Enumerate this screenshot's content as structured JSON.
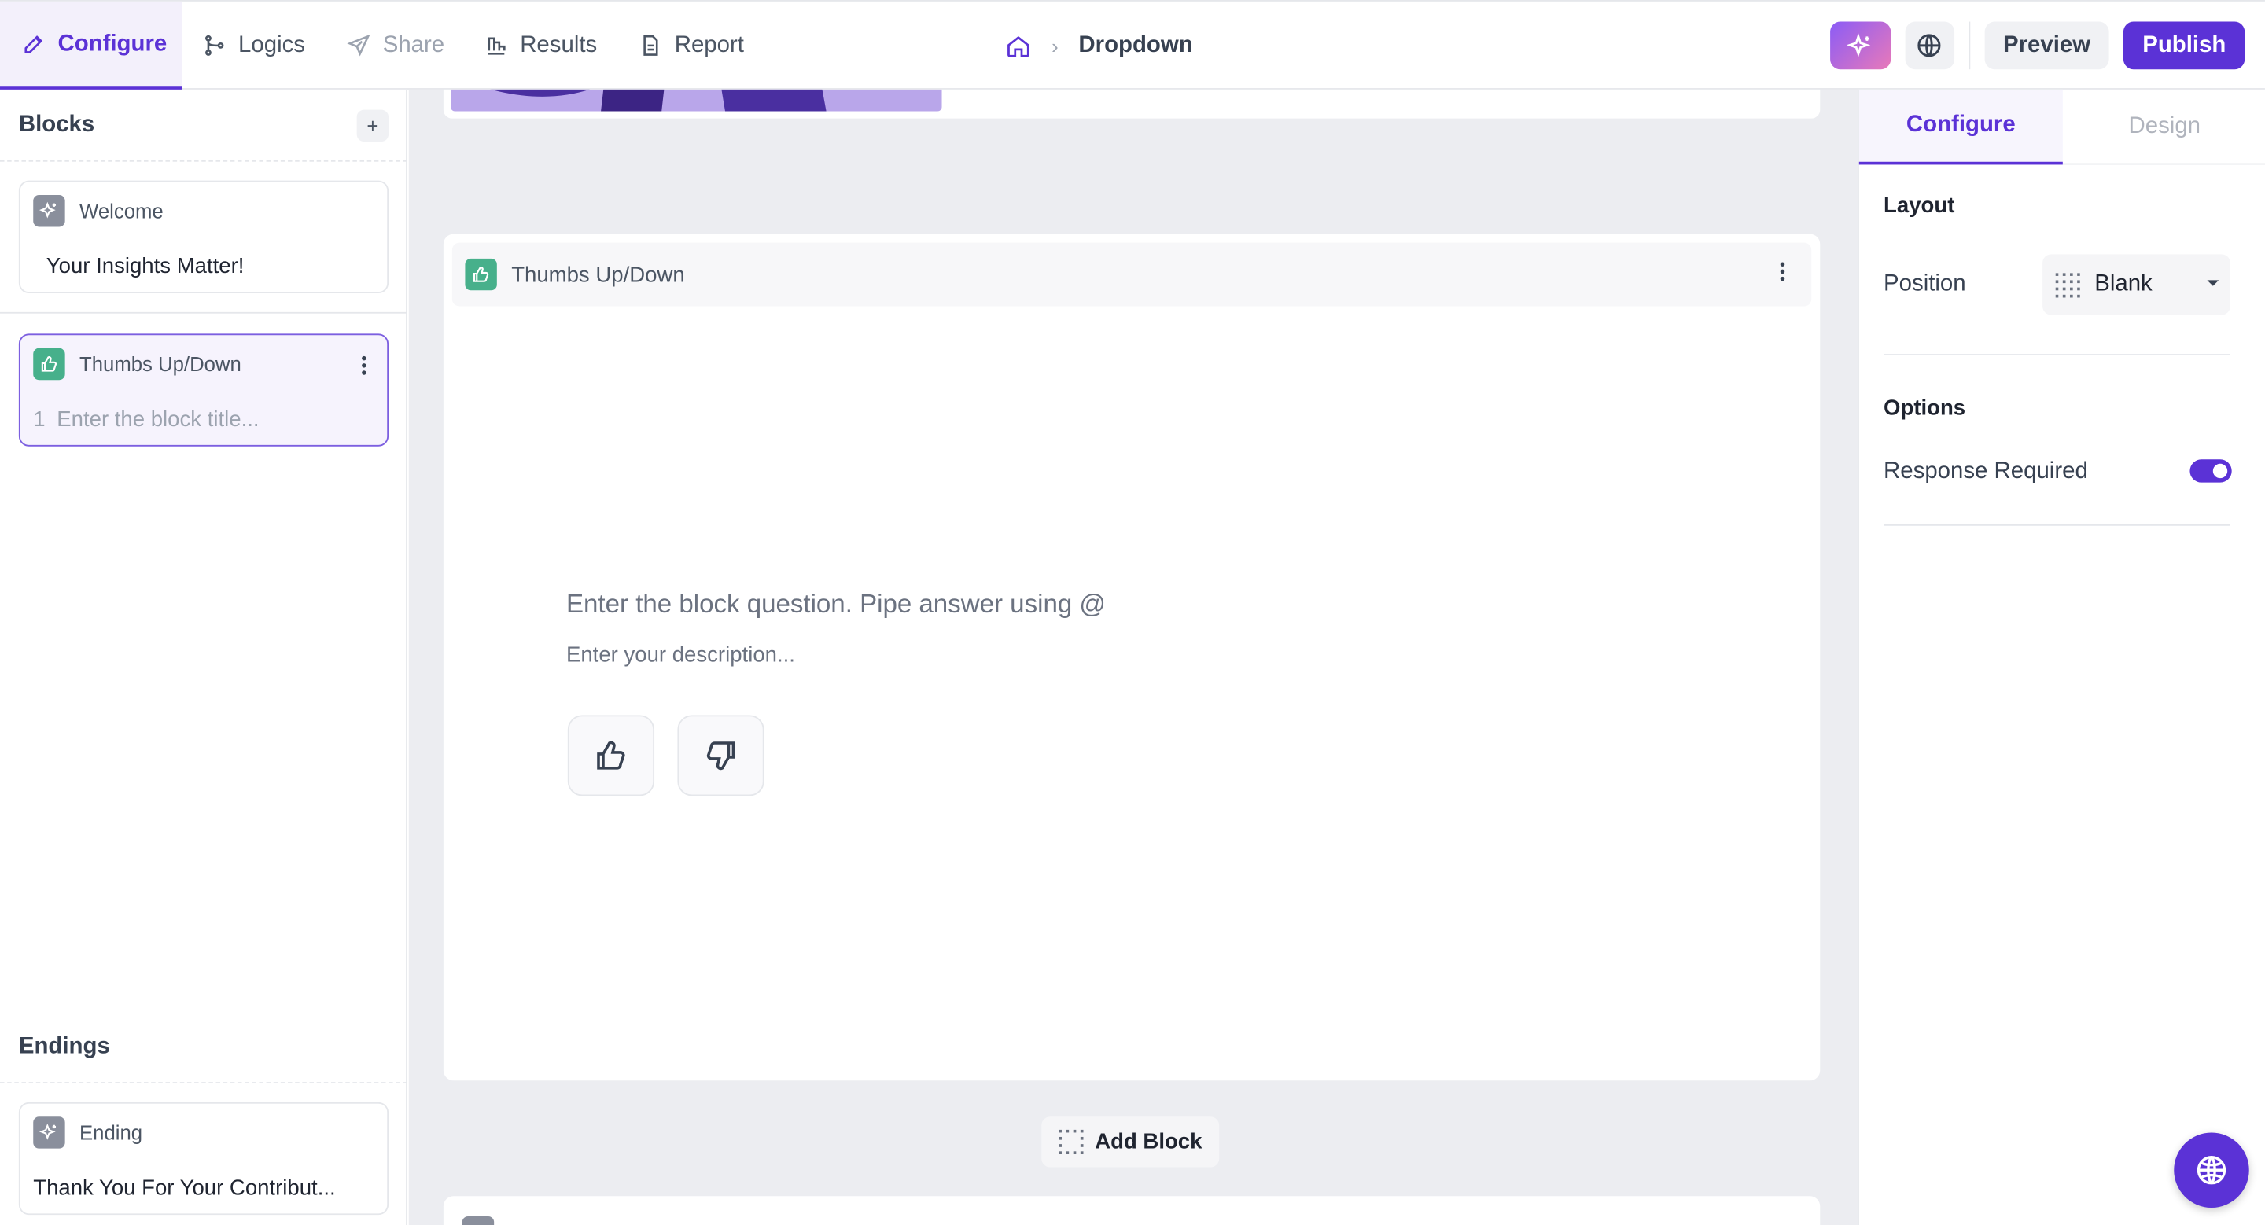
{
  "nav": {
    "tabs": [
      {
        "label": "Configure",
        "icon": "pencil-icon"
      },
      {
        "label": "Logics",
        "icon": "branch-icon"
      },
      {
        "label": "Share",
        "icon": "send-icon"
      },
      {
        "label": "Results",
        "icon": "bar-chart-icon"
      },
      {
        "label": "Report",
        "icon": "document-icon"
      }
    ],
    "breadcrumb": {
      "current": "Dropdown",
      "separator": "›"
    },
    "preview_label": "Preview",
    "publish_label": "Publish"
  },
  "sidebar": {
    "blocks_title": "Blocks",
    "add_symbol": "+",
    "blocks": [
      {
        "type": "Welcome",
        "text": "Your Insights Matter!"
      },
      {
        "type": "Thumbs Up/Down",
        "number": "1",
        "placeholder": "Enter the block title..."
      }
    ],
    "endings_title": "Endings",
    "endings": [
      {
        "type": "Ending",
        "text": "Thank You For Your Contribut..."
      }
    ]
  },
  "canvas": {
    "block_type": "Thumbs Up/Down",
    "question_placeholder": "Enter the block question. Pipe answer using @",
    "description_placeholder": "Enter your description...",
    "add_block_label": "Add Block"
  },
  "panel": {
    "tabs": [
      "Configure",
      "Design"
    ],
    "layout_title": "Layout",
    "position_label": "Position",
    "position_value": "Blank",
    "options_title": "Options",
    "response_required_label": "Response Required",
    "response_required": true
  },
  "colors": {
    "accent": "#5b32d6",
    "block_green": "#47b08b",
    "block_gray": "#8a8f9c"
  }
}
